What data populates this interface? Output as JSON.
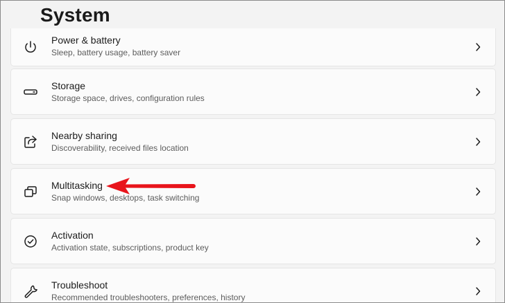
{
  "page": {
    "title": "System"
  },
  "items": [
    {
      "title": "Power & battery",
      "subtitle": "Sleep, battery usage, battery saver",
      "icon": "power-icon"
    },
    {
      "title": "Storage",
      "subtitle": "Storage space, drives, configuration rules",
      "icon": "storage-drive-icon"
    },
    {
      "title": "Nearby sharing",
      "subtitle": "Discoverability, received files location",
      "icon": "share-icon"
    },
    {
      "title": "Multitasking",
      "subtitle": "Snap windows, desktops, task switching",
      "icon": "multitasking-windows-icon"
    },
    {
      "title": "Activation",
      "subtitle": "Activation state, subscriptions, product key",
      "icon": "check-circle-icon"
    },
    {
      "title": "Troubleshoot",
      "subtitle": "Recommended troubleshooters, preferences, history",
      "icon": "wrench-icon"
    }
  ],
  "annotation": {
    "arrow_color": "#e8141b",
    "icon": "red-arrow-icon"
  },
  "colors": {
    "background": "#f3f3f3",
    "card": "#fbfbfb",
    "text": "#1b1b1b",
    "subtext": "#5c5c5c"
  }
}
